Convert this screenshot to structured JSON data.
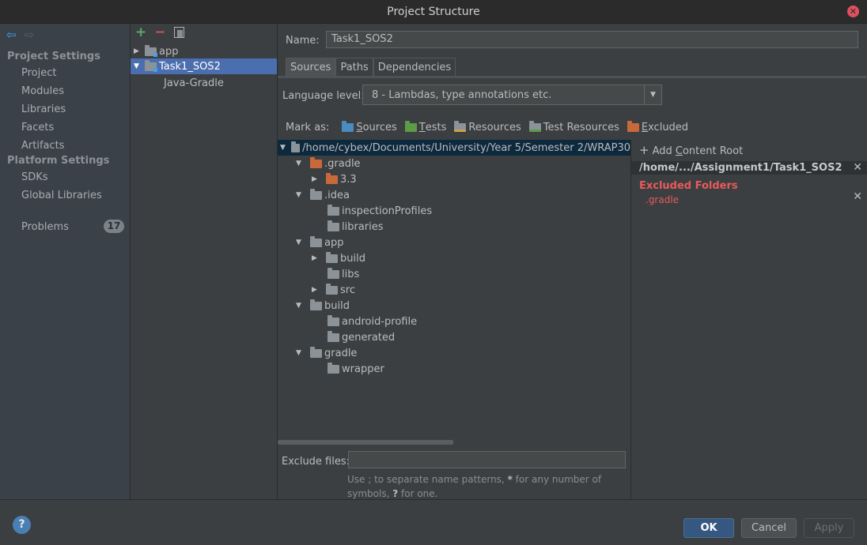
{
  "window": {
    "title": "Project Structure"
  },
  "sidebar": {
    "project_settings_header": "Project Settings",
    "project_items": [
      "Project",
      "Modules",
      "Libraries",
      "Facets",
      "Artifacts"
    ],
    "platform_settings_header": "Platform Settings",
    "platform_items": [
      "SDKs",
      "Global Libraries"
    ],
    "problems_label": "Problems",
    "problems_count": "17"
  },
  "modules": {
    "items": [
      {
        "label": "app"
      },
      {
        "label": "Task1_SOS2"
      },
      {
        "label": "Java-Gradle"
      }
    ]
  },
  "main": {
    "name_label": "Name:",
    "name_value": "Task1_SOS2",
    "tabs": [
      "Sources",
      "Paths",
      "Dependencies"
    ],
    "language_level_label": "Language level:",
    "language_level_value": "8 - Lambdas, type annotations etc.",
    "mark_as_label": "Mark as:",
    "mark_items": [
      {
        "u": "S",
        "rest": "ources"
      },
      {
        "u": "T",
        "rest": "ests"
      },
      {
        "u": "",
        "rest": "Resources"
      },
      {
        "u": "",
        "rest": "Test Resources"
      },
      {
        "u": "E",
        "rest": "xcluded"
      }
    ],
    "root_path": "/home/cybex/Documents/University/Year 5/Semester 2/WRAP30",
    "tree": [
      {
        "label": ".gradle"
      },
      {
        "label": "3.3"
      },
      {
        "label": ".idea"
      },
      {
        "label": "inspectionProfiles"
      },
      {
        "label": "libraries"
      },
      {
        "label": "app"
      },
      {
        "label": "build"
      },
      {
        "label": "libs"
      },
      {
        "label": "src"
      },
      {
        "label": "build"
      },
      {
        "label": "android-profile"
      },
      {
        "label": "generated"
      },
      {
        "label": "gradle"
      },
      {
        "label": "wrapper"
      }
    ],
    "exclude_files_label": "Exclude files:",
    "exclude_files_value": "",
    "hint_pre": "Use ; to separate name patterns, ",
    "hint_star": "*",
    "hint_mid": " for any number of symbols, ",
    "hint_q": "?",
    "hint_post": " for one."
  },
  "content_roots": {
    "add_label_pre": "Add ",
    "add_label_u": "C",
    "add_label_post": "ontent Root",
    "root_path": "/home/.../Assignment1/Task1_SOS2",
    "excluded_title": "Excluded Folders",
    "excluded_items": [
      ".gradle"
    ]
  },
  "buttons": {
    "ok": "OK",
    "cancel": "Cancel",
    "apply": "Apply",
    "help": "?"
  }
}
